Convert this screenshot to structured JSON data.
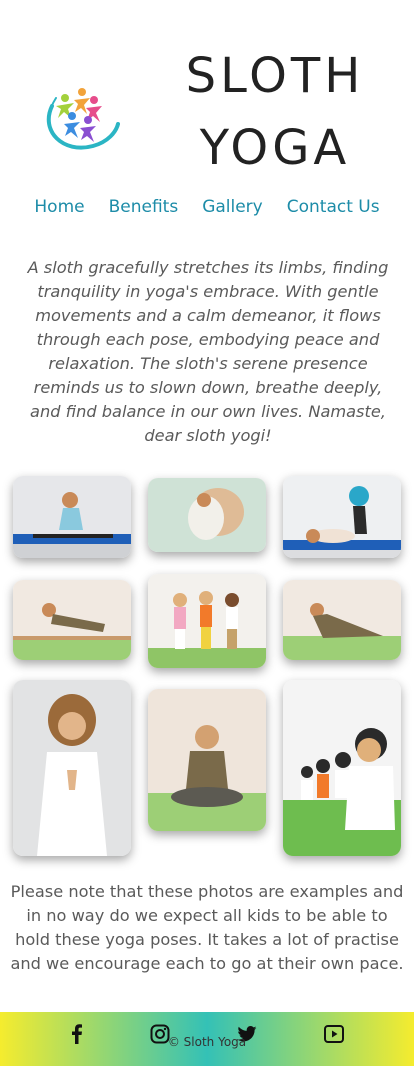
{
  "header": {
    "brand_line1": "SLOTH",
    "brand_line2": "YOGA"
  },
  "nav": [
    {
      "label": "Home"
    },
    {
      "label": "Benefits"
    },
    {
      "label": "Gallery"
    },
    {
      "label": "Contact Us"
    }
  ],
  "intro_text": "A sloth gracefully stretches its limbs, finding tranquility in yoga's embrace. With gentle movements and a calm demeanor, it flows through each pose, embodying peace and relaxation. The sloth's serene presence reminds us to slown down, breathe deeply, and find balance in our own lives. Namaste, dear sloth yogi!",
  "gallery_note": "Please note that these photos are examples and in no way do we expect all kids to be able to hold these yoga poses. It takes a lot of practise and we encourage each to go at their own pace.",
  "footer": {
    "copyright": "© Sloth Yoga",
    "icons": [
      "facebook-icon",
      "instagram-icon",
      "twitter-icon",
      "youtube-icon"
    ],
    "gradient_colors": [
      "#f5ec2e",
      "#34c1b6"
    ]
  },
  "colors": {
    "nav_link": "#1d8ca8",
    "body_text": "#5a5a5a",
    "brand_text": "#222222"
  }
}
